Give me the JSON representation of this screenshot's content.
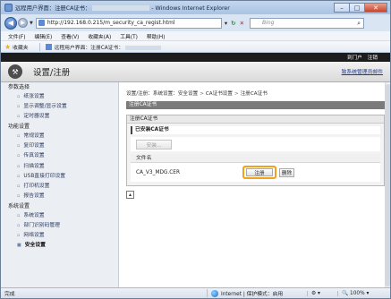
{
  "window": {
    "title_prefix": "远程用户界面：注册CA证书：",
    "title_suffix": "- Windows Internet Explorer",
    "min": "–",
    "max": "□",
    "close": "✕"
  },
  "address": {
    "url": "http://192.168.0.215/m_security_ca_regist.html",
    "search_placeholder": "Bing"
  },
  "menu": [
    "文件(F)",
    "编辑(E)",
    "查看(V)",
    "收藏夹(A)",
    "工具(T)",
    "帮助(H)"
  ],
  "favorites": {
    "label": "收藏夹",
    "tab": "远程用户界面：注册CA证书："
  },
  "top_strip": {
    "logout": "到门户",
    "login": "注销"
  },
  "header": {
    "title": "设置/注册",
    "admin_link": "致系统管理员邮件"
  },
  "sidebar": [
    {
      "type": "group",
      "label": "参数选择"
    },
    {
      "type": "item",
      "label": "纸张设置"
    },
    {
      "type": "item",
      "label": "显示调整/显示设置"
    },
    {
      "type": "item",
      "label": "定时器设置"
    },
    {
      "type": "group",
      "label": "功能设置"
    },
    {
      "type": "item",
      "label": "常规设置"
    },
    {
      "type": "item",
      "label": "复印设置"
    },
    {
      "type": "item",
      "label": "传真设置"
    },
    {
      "type": "item",
      "label": "扫描设置"
    },
    {
      "type": "item",
      "label": "USB直接打印设置"
    },
    {
      "type": "item",
      "label": "打印机设置"
    },
    {
      "type": "item",
      "label": "报告设置"
    },
    {
      "type": "group",
      "label": "系统设置"
    },
    {
      "type": "item",
      "label": "系统设置"
    },
    {
      "type": "item",
      "label": "部门识别码管理"
    },
    {
      "type": "item",
      "label": "网络设置"
    },
    {
      "type": "item",
      "label": "安全设置",
      "active": true
    }
  ],
  "breadcrumb": [
    "设置/注册：系统设置：安全设置",
    "CA证书设置",
    "注册CA证书"
  ],
  "main": {
    "section_title": "注册CA证书",
    "panel_title": "注册CA证书",
    "installed_title": "已安装CA证书",
    "install_button": "安装...",
    "table_header": "文件名",
    "rows": [
      {
        "file": "CA_V3_MDG.CER",
        "register": "注册",
        "delete": "删除"
      }
    ]
  },
  "status": {
    "done": "完成",
    "zone": "Internet | 保护模式：启用",
    "security": "⚙ ▾",
    "zoom": "🔍 100% ▾"
  },
  "colors": {
    "highlight": "#f2a21a",
    "section_head": "#7b7b7b",
    "sidebar_bg": "#ebeef3"
  }
}
